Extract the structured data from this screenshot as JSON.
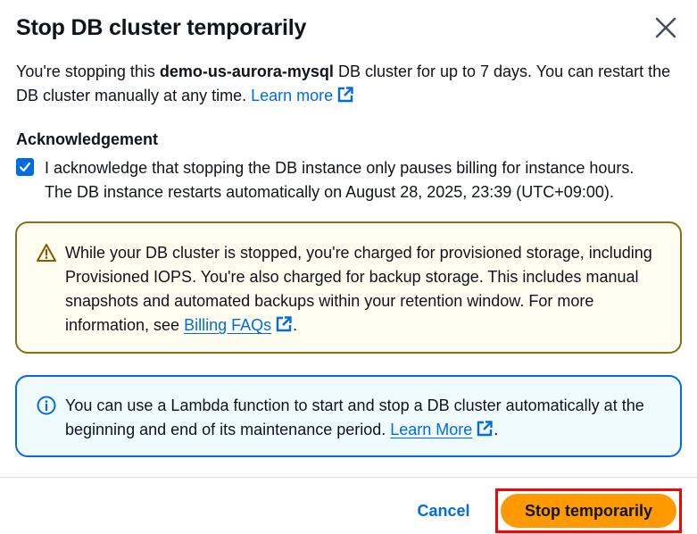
{
  "modal": {
    "title": "Stop DB cluster temporarily",
    "close_icon": "close-icon"
  },
  "intro": {
    "prefix": "You're stopping this ",
    "cluster_name": "demo-us-aurora-mysql",
    "suffix": " DB cluster for up to 7 days. You can restart the DB cluster manually at any time. ",
    "link": "Learn more"
  },
  "acknowledgement": {
    "label": "Acknowledgement",
    "checked": true,
    "line1": "I acknowledge that stopping the DB instance only pauses billing for instance hours.",
    "line2": "The DB instance restarts automatically on August 28, 2025, 23:39 (UTC+09:00)."
  },
  "warning_alert": {
    "icon": "warning-icon",
    "text": "While your DB cluster is stopped, you're charged for provisioned storage, including Provisioned IOPS. You're also charged for backup storage. This includes manual snapshots and automated backups within your retention window. For more information, see ",
    "link": "Billing FAQs",
    "end": "."
  },
  "info_alert": {
    "icon": "info-icon",
    "text": "You can use a Lambda function to start and stop a DB cluster automatically at the beginning and end of its maintenance period. ",
    "link": "Learn More",
    "end": "."
  },
  "footer": {
    "cancel_label": "Cancel",
    "stop_label": "Stop temporarily"
  },
  "colors": {
    "link": "#006ce0",
    "primary_button": "#ff9900",
    "warning_border": "#8b6e19",
    "info_border": "#006ce0",
    "highlight": "#ff0000"
  }
}
